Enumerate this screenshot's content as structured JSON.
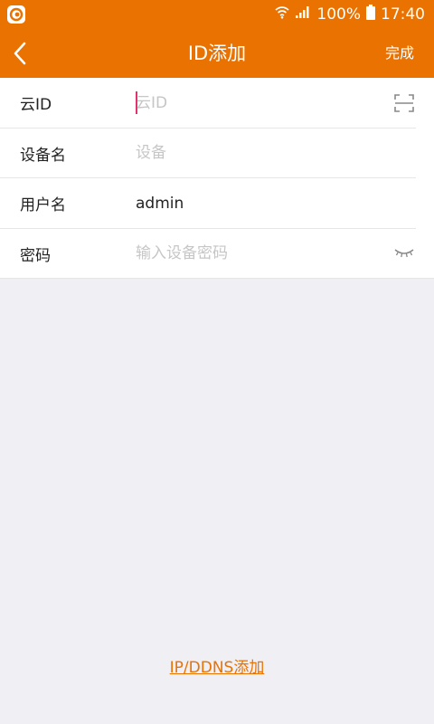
{
  "status_bar": {
    "battery": "100%",
    "time": "17:40",
    "icons": [
      "app-logo-icon",
      "wifi-icon",
      "signal-icon",
      "battery-icon"
    ]
  },
  "nav": {
    "title": "ID添加",
    "done_label": "完成",
    "back_icon": "chevron-left-icon"
  },
  "form": {
    "cloud_id": {
      "label": "云ID",
      "placeholder": "云ID",
      "value": "",
      "icon": "scan-icon"
    },
    "device_name": {
      "label": "设备名",
      "placeholder": "设备",
      "value": ""
    },
    "username": {
      "label": "用户名",
      "value": "admin"
    },
    "password": {
      "label": "密码",
      "placeholder": "输入设备密码",
      "value": "",
      "icon": "eye-closed-icon"
    }
  },
  "footer": {
    "link_label": "IP/DDNS添加"
  },
  "colors": {
    "accent": "#ea7200",
    "background": "#efeff4",
    "caret": "#e5306e"
  }
}
